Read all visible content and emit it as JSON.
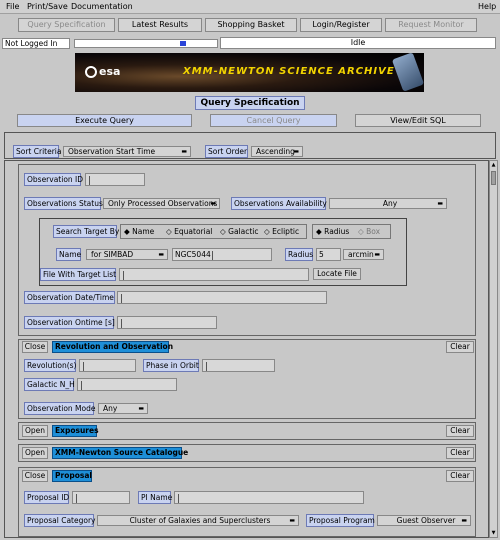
{
  "menu": {
    "file": "File",
    "print_save": "Print/Save",
    "documentation": "Documentation",
    "help": "Help"
  },
  "toolbar": {
    "query_specification": "Query Specification",
    "latest_results": "Latest Results",
    "shopping_basket": "Shopping Basket",
    "login_register": "Login/Register",
    "request_monitor": "Request Monitor"
  },
  "status": {
    "login": "Not Logged In",
    "state": "Idle",
    "progress": 0.77
  },
  "banner": {
    "esa": "esa",
    "title": "XMM-NEWTON  SCIENCE  ARCHIVE"
  },
  "page_title": "Query Specification",
  "actions": {
    "execute": "Execute Query",
    "cancel": "Cancel Query",
    "view_sql": "View/Edit SQL"
  },
  "sort": {
    "criteria_label": "Sort Criteria",
    "criteria_value": "Observation Start Time",
    "order_label": "Sort Order",
    "order_value": "Ascending"
  },
  "observation": {
    "obs_id_label": "Observation ID",
    "obs_status_label": "Observations Status",
    "obs_status_value": "Only Processed Observations",
    "obs_avail_label": "Observations Availability",
    "obs_avail_value": "Any",
    "search_target_label": "Search Target By",
    "radio_name": "Name",
    "radio_equatorial": "Equatorial",
    "radio_galactic": "Galactic",
    "radio_ecliptic": "Ecliptic",
    "radio_radius": "Radius",
    "radio_box": "Box",
    "name_label": "Name",
    "name_resolver": "for SIMBAD",
    "name_value": "NGC5044",
    "radius_label": "Radius",
    "radius_value": "5",
    "radius_unit": "arcmin",
    "file_target_label": "File With Target List",
    "locate_file": "Locate File",
    "obs_date_label": "Observation Date/Time",
    "obs_ontime_label": "Observation Ontime [s]"
  },
  "rev_section": {
    "close": "Close",
    "title": "Revolution and Observation",
    "clear": "Clear",
    "revolution_label": "Revolution(s)",
    "phase_label": "Phase in Orbit",
    "galactic_nh_label": "Galactic N_H",
    "obs_mode_label": "Observation Mode",
    "obs_mode_value": "Any"
  },
  "exposures_section": {
    "open": "Open",
    "title": "Exposures",
    "clear": "Clear"
  },
  "catalogue_section": {
    "open": "Open",
    "title": "XMM-Newton Source Catalogue",
    "clear": "Clear"
  },
  "proposal_section": {
    "close": "Close",
    "title": "Proposal",
    "clear": "Clear",
    "proposal_id_label": "Proposal ID",
    "pi_name_label": "PI Name",
    "proposal_category_label": "Proposal Category",
    "proposal_category_value": "Cluster of Galaxies and Superclusters",
    "proposal_program_label": "Proposal Program",
    "proposal_program_value": "Guest Observer"
  }
}
